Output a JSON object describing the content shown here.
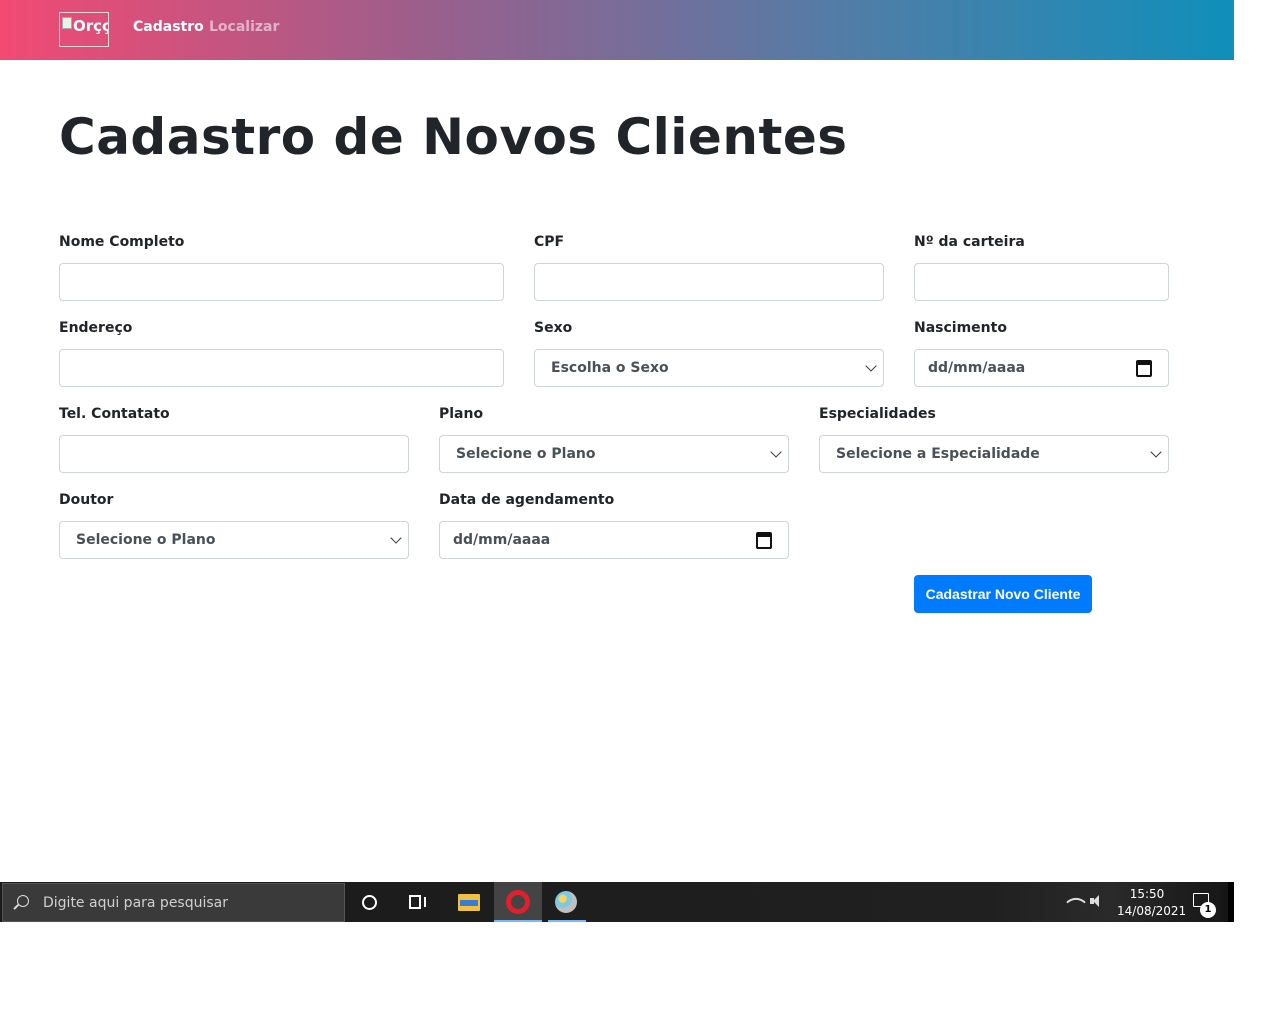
{
  "navbar": {
    "brand_alt": "Orçç",
    "links": [
      {
        "label": "Cadastro",
        "active": true
      },
      {
        "label": "Localizar",
        "active": false
      }
    ],
    "gradient": [
      "#f24a73",
      "#0f8fba"
    ]
  },
  "page": {
    "title": "Cadastro de Novos Clientes"
  },
  "form": {
    "nome": {
      "label": "Nome Completo",
      "value": ""
    },
    "cpf": {
      "label": "CPF",
      "value": ""
    },
    "carteira": {
      "label": "Nº da carteira",
      "value": ""
    },
    "endereco": {
      "label": "Endereço",
      "value": ""
    },
    "sexo": {
      "label": "Sexo",
      "selected": "Escolha o Sexo"
    },
    "nascimento": {
      "label": "Nascimento",
      "placeholder": "dd/mm/aaaa"
    },
    "telefone": {
      "label": "Tel. Contatato",
      "value": ""
    },
    "plano": {
      "label": "Plano",
      "selected": "Selecione o Plano"
    },
    "especialidades": {
      "label": "Especialidades",
      "selected": "Selecione a Especialidade"
    },
    "doutor": {
      "label": "Doutor",
      "selected": "Selecione o Plano"
    },
    "agendamento": {
      "label": "Data de agendamento",
      "placeholder": "dd/mm/aaaa"
    },
    "submit_label": "Cadastrar Novo Cliente",
    "submit_color": "#007bff"
  },
  "taskbar": {
    "search_placeholder": "Digite aqui para pesquisar",
    "time": "15:50",
    "date": "14/08/2021",
    "notification_count": "1",
    "apps": [
      "cortana-icon",
      "task-view-icon",
      "file-explorer-icon",
      "opera-icon",
      "paint-icon"
    ]
  }
}
